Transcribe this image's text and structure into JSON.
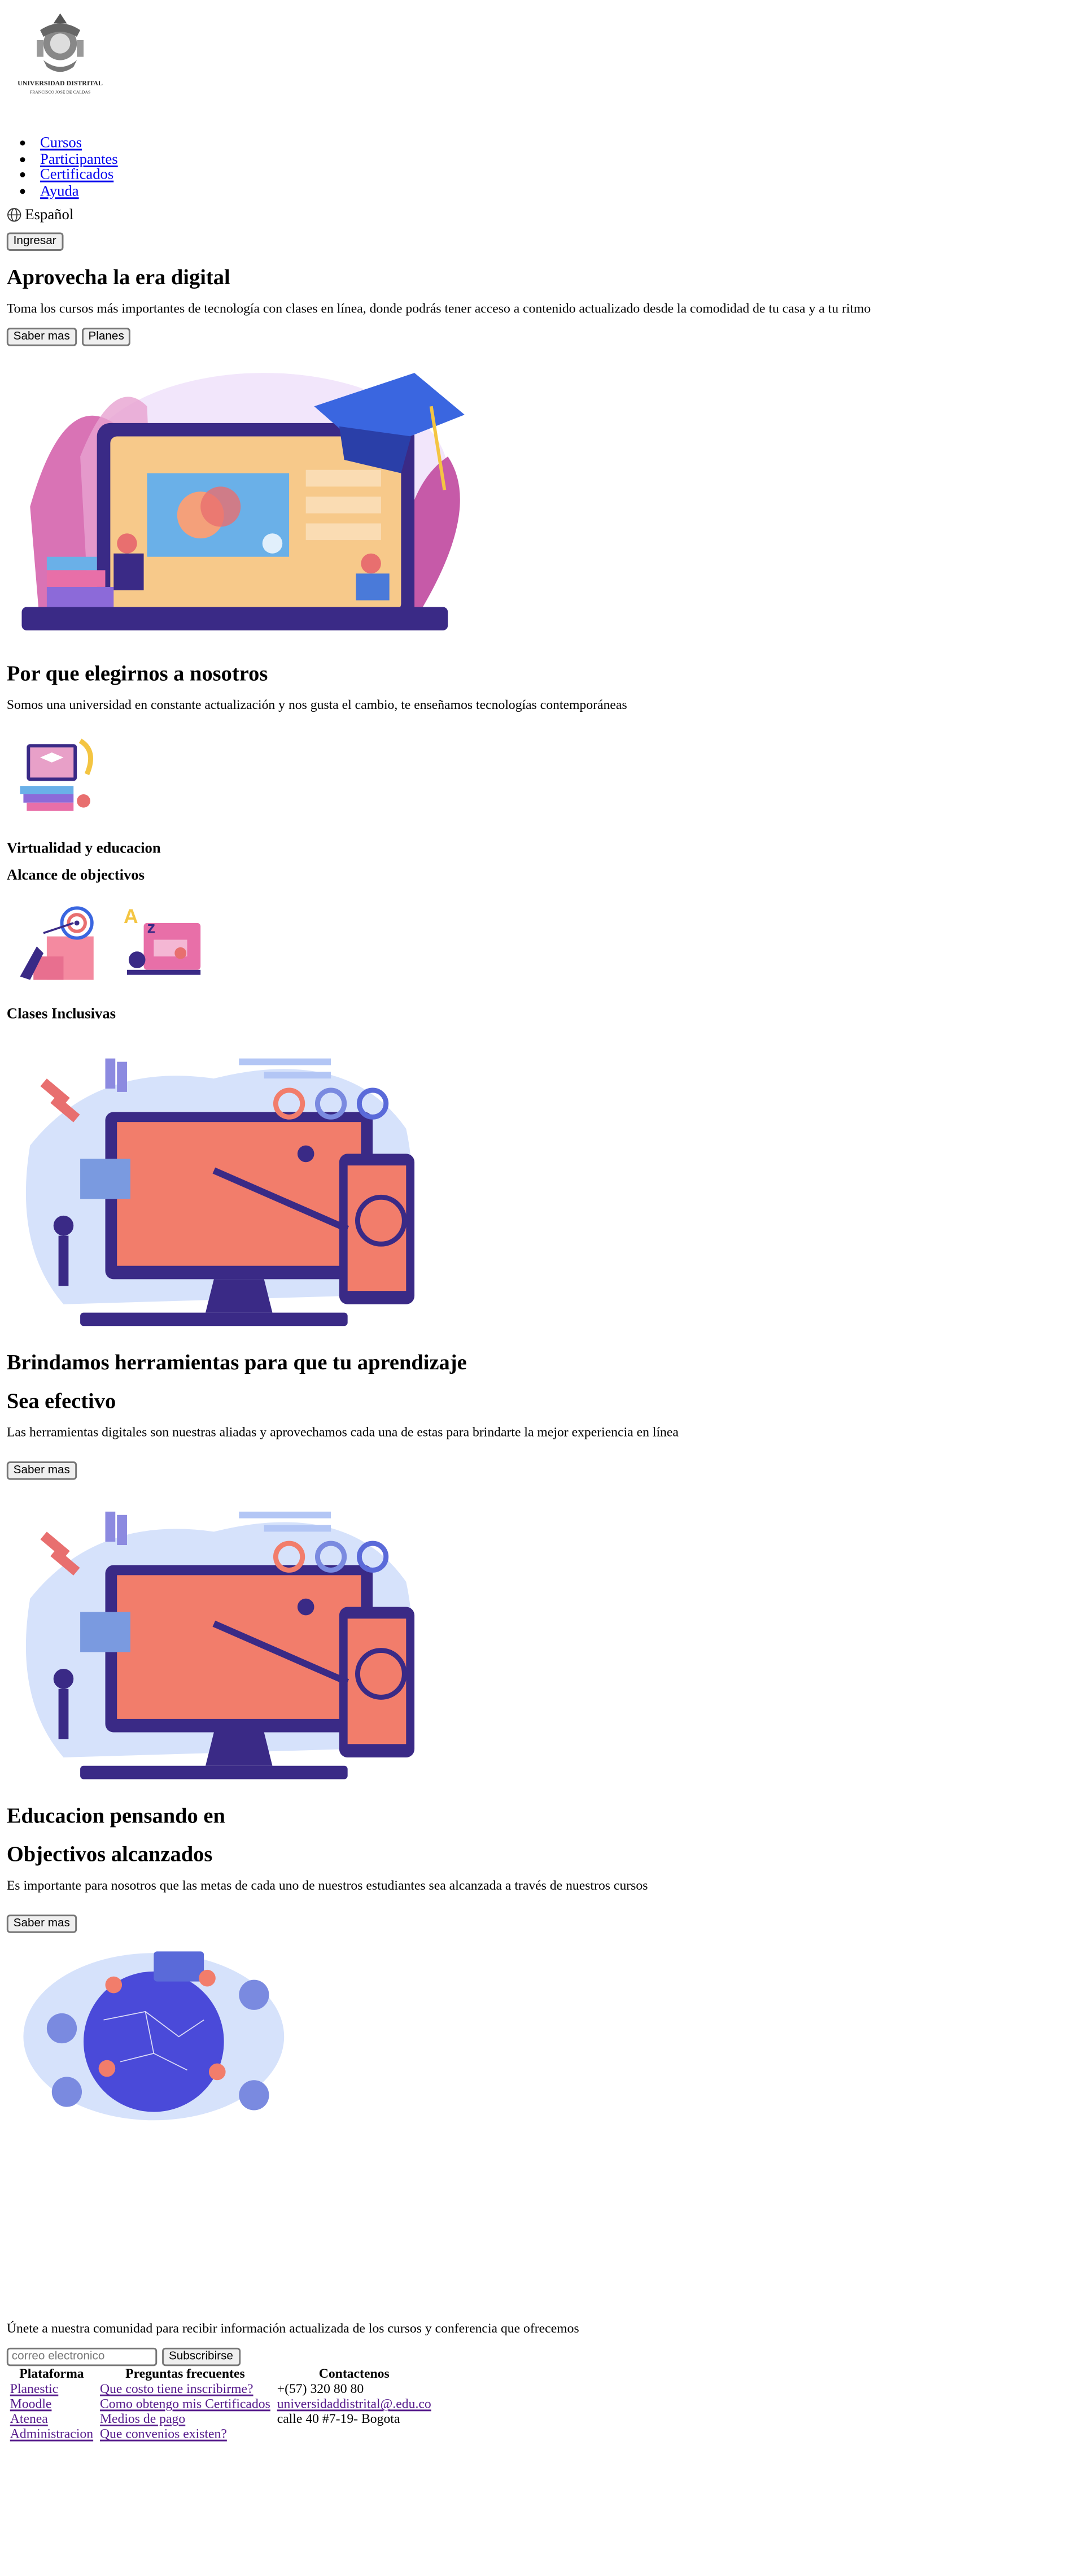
{
  "brand": {
    "name_line1": "UNIVERSIDAD DISTRITAL",
    "name_line2": "FRANCISCO JOSÉ DE CALDAS"
  },
  "nav": {
    "items": [
      {
        "label": "Cursos"
      },
      {
        "label": "Participantes"
      },
      {
        "label": "Certificados"
      },
      {
        "label": "Ayuda"
      }
    ]
  },
  "lang": {
    "icon": "globe-icon",
    "label": "Español"
  },
  "login_label": "Ingresar",
  "hero": {
    "title": "Aprovecha la era digital",
    "text": "Toma los cursos más importantes de tecnología con clases en línea, donde podrás tener acceso a contenido actualizado desde la comodidad de tu casa y a tu ritmo",
    "btn_more": "Saber mas",
    "btn_plans": "Planes"
  },
  "why": {
    "title": "Por que elegirnos a nosotros",
    "text": "Somos una universidad en constante actualización y nos gusta el cambio, te enseñamos tecnologías contemporáneas",
    "feature1": "Virtualidad y educacion",
    "feature2": "Alcance de objectivos",
    "feature3": "Clases Inclusivas"
  },
  "tools": {
    "title": "Brindamos herramientas para que tu aprendizaje",
    "subtitle": "Sea efectivo",
    "text": "Las herramientas digitales son nuestras aliadas y aprovechamos cada una de estas para brindarte la mejor experiencia en línea",
    "btn": "Saber mas"
  },
  "goals": {
    "title": "Educacion pensando en",
    "subtitle": "Objectivos alcanzados",
    "text": "Es importante para nosotros que las metas de cada uno de nuestros estudiantes sea alcanzada a través de nuestros cursos",
    "btn": "Saber mas"
  },
  "newsletter": {
    "text": "Únete a nuestra comunidad para recibir información actualizada de los cursos y conferencia que ofrecemos",
    "placeholder": "correo electronico",
    "btn": "Subscribirse"
  },
  "footer": {
    "col1_header": "Plataforma",
    "col2_header": "Preguntas frecuentes",
    "col3_header": "Contactenos",
    "rows": [
      {
        "c1": "Planestic",
        "c2": "Que costo tiene inscribirme?",
        "c3": "+(57) 320 80 80"
      },
      {
        "c1": "Moodle",
        "c2": "Como obtengo mis Certificados",
        "c3": "universidaddistrital@.edu.co"
      },
      {
        "c1": "Atenea",
        "c2": "Medios de pago",
        "c3": "calle 40 #7-19- Bogota"
      },
      {
        "c1": "Administracion",
        "c2": "Que convenios existen?",
        "c3": ""
      }
    ]
  }
}
